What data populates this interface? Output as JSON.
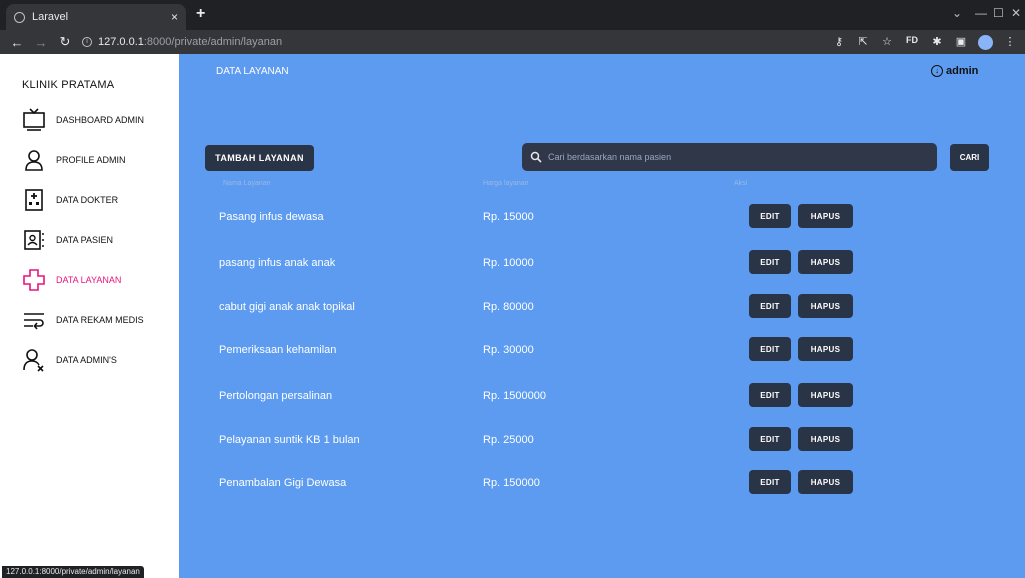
{
  "browser": {
    "tab_title": "Laravel",
    "tab_close": "×",
    "new_tab": "+",
    "url_host": "127.0.0.1",
    "url_port_path": ":8000/private/admin/layanan",
    "status_url": "127.0.0.1:8000/private/admin/layanan",
    "profile_initials": "FD"
  },
  "sidebar": {
    "brand": "KLINIK PRATAMA",
    "items": [
      {
        "label": "DASHBOARD ADMIN",
        "icon": "monitor-icon",
        "active": false
      },
      {
        "label": "PROFILE ADMIN",
        "icon": "user-icon",
        "active": false
      },
      {
        "label": "DATA DOKTER",
        "icon": "hospital-icon",
        "active": false
      },
      {
        "label": "DATA PASIEN",
        "icon": "contact-book-icon",
        "active": false
      },
      {
        "label": "DATA LAYANAN",
        "icon": "medical-cross-icon",
        "active": true
      },
      {
        "label": "DATA REKAM MEDIS",
        "icon": "records-icon",
        "active": false
      },
      {
        "label": "DATA ADMIN'S",
        "icon": "user-remove-icon",
        "active": false
      }
    ]
  },
  "header": {
    "title": "DATA LAYANAN",
    "user": "admin"
  },
  "toolbar": {
    "add_label": "TAMBAH LAYANAN",
    "search_placeholder": "Cari berdasarkan nama pasien",
    "search_button": "CARI"
  },
  "table": {
    "columns": [
      "Nama Layanan",
      "Harga layanan",
      "Aksi"
    ],
    "edit_label": "EDIT",
    "delete_label": "HAPUS",
    "rows": [
      {
        "name": "Pasang infus dewasa",
        "price": "Rp. 15000"
      },
      {
        "name": "pasang infus anak anak",
        "price": "Rp. 10000"
      },
      {
        "name": "cabut gigi anak anak topikal",
        "price": "Rp. 80000"
      },
      {
        "name": "Pemeriksaan kehamilan",
        "price": "Rp. 30000"
      },
      {
        "name": "Pertolongan persalinan",
        "price": "Rp. 1500000"
      },
      {
        "name": "Pelayanan suntik KB 1 bulan",
        "price": "Rp. 25000"
      },
      {
        "name": "Penambalan Gigi Dewasa",
        "price": "Rp. 150000"
      }
    ]
  },
  "colors": {
    "main_bg": "#5c9bf0",
    "dark_button": "#2a3447",
    "active_accent": "#e9157a"
  }
}
